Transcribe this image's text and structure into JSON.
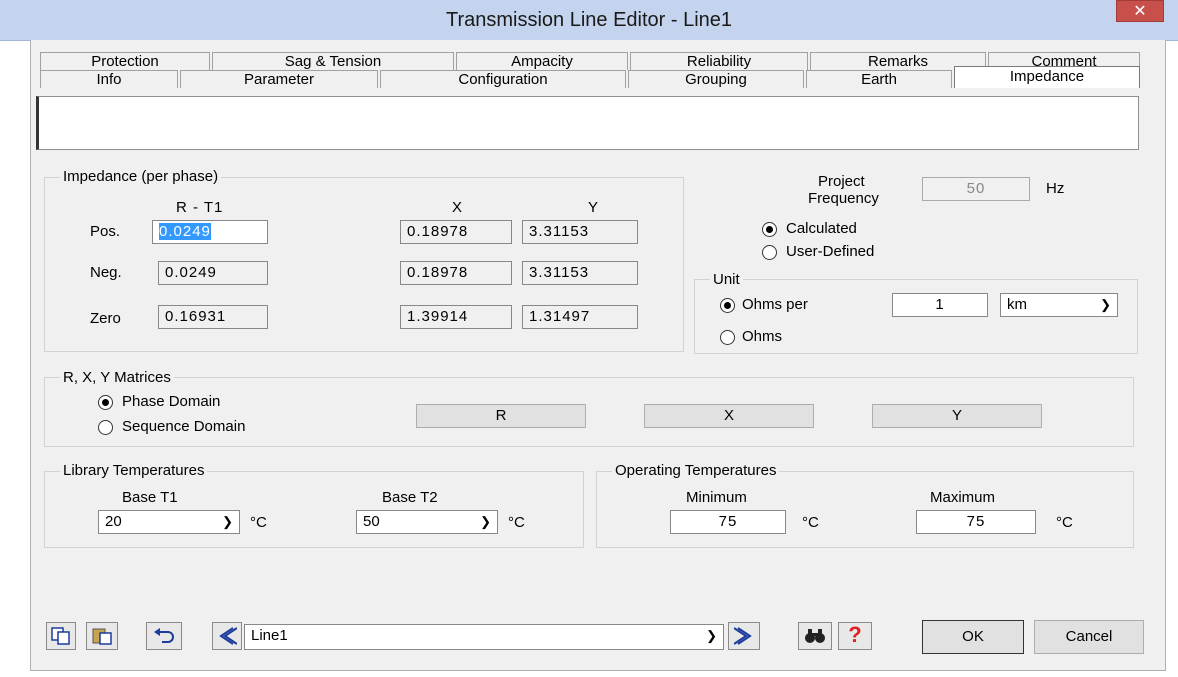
{
  "window": {
    "title": "Transmission Line Editor - Line1",
    "close_glyph": "✕"
  },
  "tabs_row1": [
    "Protection",
    "Sag & Tension",
    "Ampacity",
    "Reliability",
    "Remarks",
    "Comment"
  ],
  "tabs_row2": [
    "Info",
    "Parameter",
    "Configuration",
    "Grouping",
    "Earth",
    "Impedance"
  ],
  "impedance": {
    "group_label": "Impedance (per phase)",
    "col_r": "R - T1",
    "col_x": "X",
    "col_y": "Y",
    "rows": [
      {
        "label": "Pos.",
        "r": "0.0249",
        "x": "0.18978",
        "y": "3.31153"
      },
      {
        "label": "Neg.",
        "r": "0.0249",
        "x": "0.18978",
        "y": "3.31153"
      },
      {
        "label": "Zero",
        "r": "0.16931",
        "x": "1.39914",
        "y": "1.31497"
      }
    ]
  },
  "frequency": {
    "label_line1": "Project",
    "label_line2": "Frequency",
    "value": "50",
    "unit": "Hz",
    "opt_calculated": "Calculated",
    "opt_user": "User-Defined",
    "selected": "Calculated"
  },
  "unit": {
    "group_label": "Unit",
    "opt_ohms_per": "Ohms per",
    "length": "1",
    "length_unit": "km",
    "opt_ohms": "Ohms",
    "selected": "Ohms per"
  },
  "matrices": {
    "group_label": "R, X, Y Matrices",
    "opt_phase": "Phase Domain",
    "opt_sequence": "Sequence Domain",
    "selected": "Phase Domain",
    "btn_r": "R",
    "btn_x": "X",
    "btn_y": "Y"
  },
  "library_temps": {
    "group_label": "Library Temperatures",
    "t1_label": "Base T1",
    "t1_value": "20",
    "t2_label": "Base T2",
    "t2_value": "50",
    "unit": "°C"
  },
  "operating_temps": {
    "group_label": "Operating Temperatures",
    "min_label": "Minimum",
    "min_value": "75",
    "max_label": "Maximum",
    "max_value": "75",
    "unit": "°C"
  },
  "bottom": {
    "copy_icon": "copy-icon",
    "paste_icon": "paste-icon",
    "undo_icon": "undo-icon",
    "prev_icon": "prev-icon",
    "next_icon": "next-icon",
    "find_icon": "binoculars-icon",
    "help_icon": "help-icon",
    "line_select": "Line1",
    "ok": "OK",
    "cancel": "Cancel"
  },
  "colors": {
    "titlebar": "#c4d4ee",
    "close": "#c7504b",
    "accent_blue": "#3399ff",
    "help_red": "#e02020"
  }
}
